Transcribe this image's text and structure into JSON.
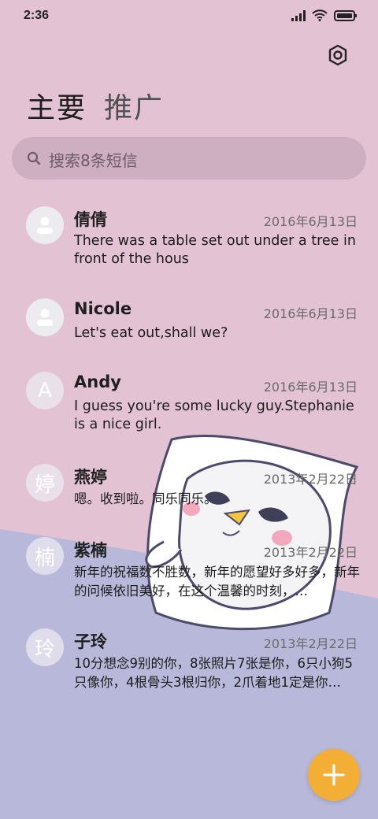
{
  "status_bar": {
    "time": "2:36"
  },
  "tabs": [
    {
      "label": "主要"
    },
    {
      "label": "推广"
    }
  ],
  "search": {
    "placeholder": "搜索8条短信"
  },
  "conversations": [
    {
      "name": "倩倩",
      "date": "2016年6月13日",
      "message": "There was a table set out under a tree in front of the hous",
      "avatar": ""
    },
    {
      "name": "Nicole",
      "date": "2016年6月13日",
      "message": "Let's eat out,shall we?",
      "avatar": ""
    },
    {
      "name": "Andy",
      "date": "2016年6月13日",
      "message": "I guess you're some lucky guy.Stephanie is a nice girl.",
      "avatar": "A"
    },
    {
      "name": "燕婷",
      "date": "2013年2月22日",
      "message": "嗯。收到啦。同乐同乐。",
      "avatar": "婷"
    },
    {
      "name": "紫楠",
      "date": "2013年2月22日",
      "message": "新年的祝福数不胜数，新年的愿望好多好多，新年的问候依旧美好，在这个温馨的时刻，…",
      "avatar": "楠"
    },
    {
      "name": "子玲",
      "date": "2013年2月22日",
      "message": "10分想念9别的你，8张照片7张是你，6只小狗5只像你，4根骨头3根归你，2爪着地1定是你…",
      "avatar": "玲"
    }
  ],
  "colors": {
    "background_top": "#e3c2d3",
    "background_bottom": "#b8b8da",
    "fab": "#f2ae35"
  },
  "icons": [
    "signal-icon",
    "wifi-icon",
    "battery-icon",
    "settings-icon",
    "search-icon",
    "person-icon",
    "plus-icon"
  ]
}
